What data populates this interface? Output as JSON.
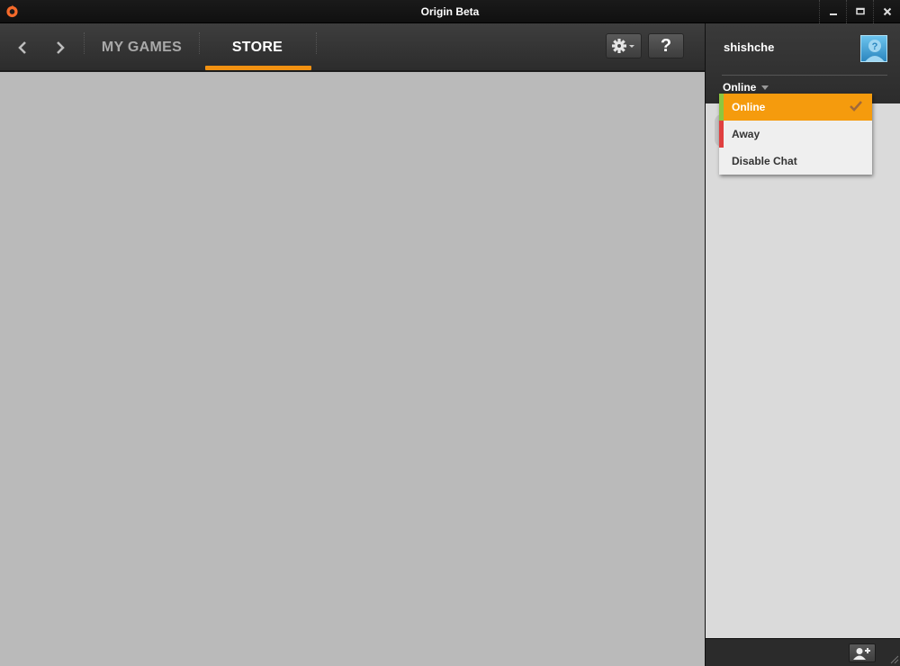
{
  "window": {
    "title": "Origin Beta",
    "icons": [
      "origin-logo-icon",
      "minimize-icon",
      "maximize-icon",
      "close-icon"
    ]
  },
  "nav": {
    "back_icon": "chevron-left-icon",
    "forward_icon": "chevron-right-icon",
    "tabs": [
      {
        "label": "MY GAMES",
        "active": false
      },
      {
        "label": "STORE",
        "active": true
      }
    ],
    "settings_icon": "gear-icon",
    "help_label": "?"
  },
  "friends": {
    "username": "shishche",
    "avatar_icon": "default-avatar-icon",
    "status": "Online",
    "add_friend_icon": "add-friend-icon"
  },
  "status_menu": {
    "items": [
      {
        "label": "Online",
        "selected": true,
        "color": "#8cc63f"
      },
      {
        "label": "Away",
        "selected": false,
        "color": "#e04040"
      },
      {
        "label": "Disable Chat",
        "selected": false,
        "color": ""
      }
    ]
  },
  "colors": {
    "accent": "#f29111",
    "content_bg": "#bababa",
    "panel_bg": "#dadada"
  }
}
